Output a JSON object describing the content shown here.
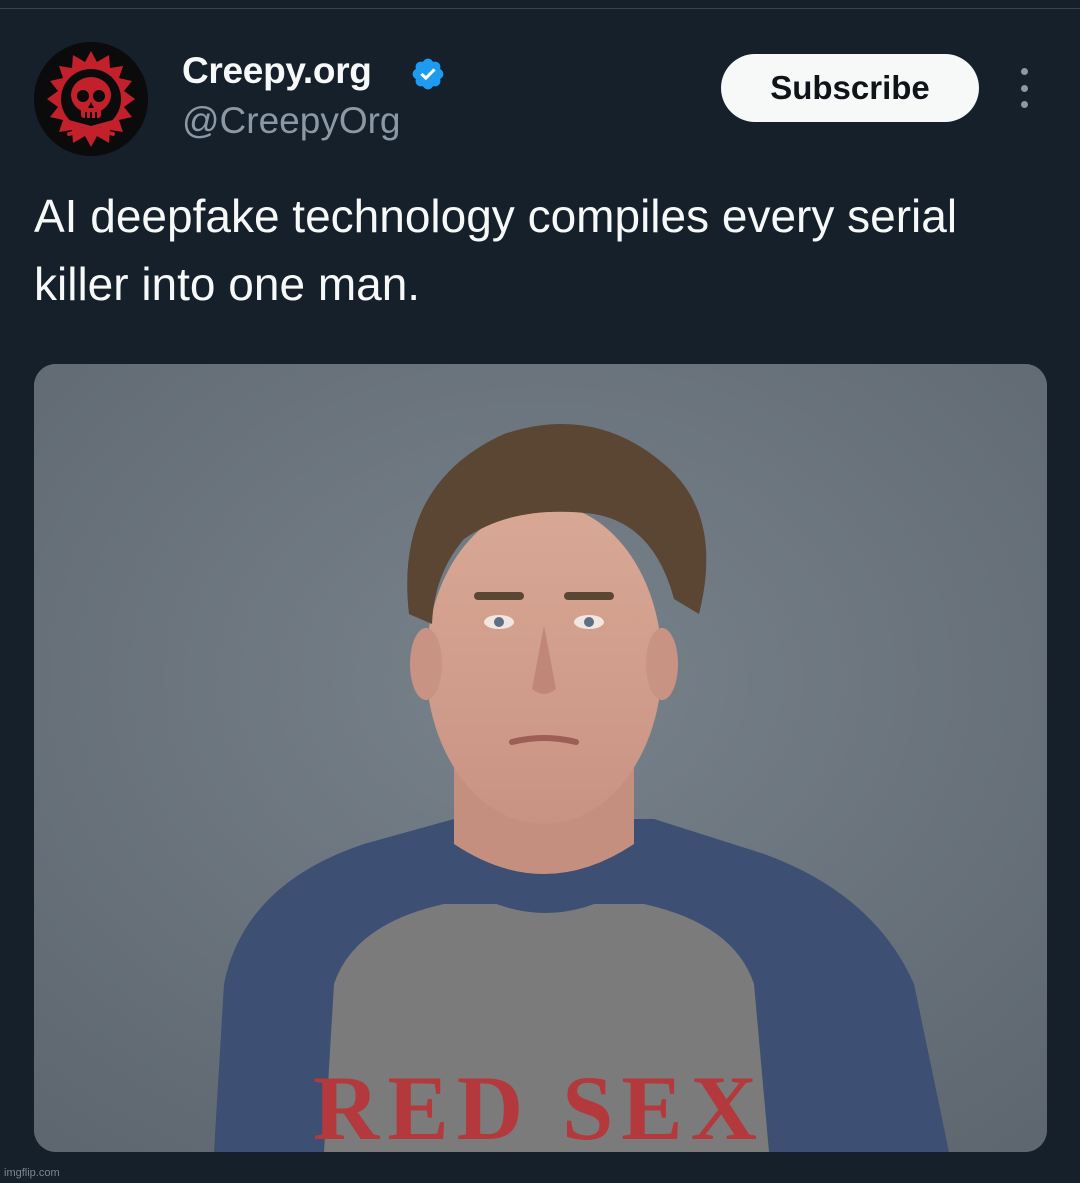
{
  "account": {
    "display_name": "Creepy.org",
    "handle": "@CreepyOrg",
    "verified": true,
    "verified_color": "#1d9bf0",
    "avatar_icon": "red-skull-logo"
  },
  "header": {
    "subscribe_label": "Subscribe",
    "more_icon": "vertical-ellipsis"
  },
  "tweet": {
    "text": "AI deepfake technology compiles every serial killer into one man."
  },
  "media": {
    "shirt_text": "RED SEX"
  },
  "watermark": "imgflip.com",
  "colors": {
    "background": "#15202b",
    "text_primary": "#f7f9f9",
    "text_secondary": "#8b98a5",
    "button_bg": "#f7f9f9",
    "button_text": "#0f1419"
  }
}
